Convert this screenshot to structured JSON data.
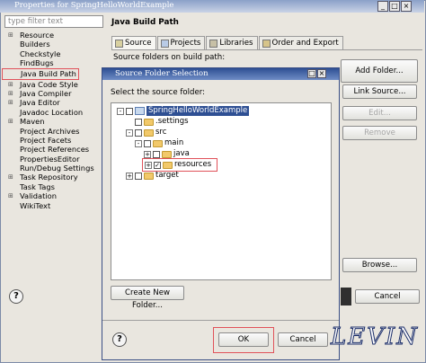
{
  "outer": {
    "title": "Properties for SpringHelloWorldExample",
    "filter_placeholder": "type filter text"
  },
  "left_tree": {
    "items": [
      {
        "label": "Resource",
        "expandable": true
      },
      {
        "label": "Builders",
        "expandable": false
      },
      {
        "label": "Checkstyle",
        "expandable": false
      },
      {
        "label": "FindBugs",
        "expandable": false
      },
      {
        "label": "Java Build Path",
        "expandable": false,
        "highlighted": true
      },
      {
        "label": "Java Code Style",
        "expandable": true
      },
      {
        "label": "Java Compiler",
        "expandable": true
      },
      {
        "label": "Java Editor",
        "expandable": true
      },
      {
        "label": "Javadoc Location",
        "expandable": false
      },
      {
        "label": "Maven",
        "expandable": true
      },
      {
        "label": "Project Archives",
        "expandable": false
      },
      {
        "label": "Project Facets",
        "expandable": false
      },
      {
        "label": "Project References",
        "expandable": false
      },
      {
        "label": "PropertiesEditor",
        "expandable": false
      },
      {
        "label": "Run/Debug Settings",
        "expandable": false
      },
      {
        "label": "Task Repository",
        "expandable": true
      },
      {
        "label": "Task Tags",
        "expandable": false
      },
      {
        "label": "Validation",
        "expandable": true
      },
      {
        "label": "WikiText",
        "expandable": false
      }
    ]
  },
  "build_path": {
    "title": "Java Build Path",
    "tabs": [
      "Source",
      "Projects",
      "Libraries",
      "Order and Export"
    ],
    "source_folders_label": "Source folders on build path:",
    "buttons": {
      "add_folder": "Add Folder...",
      "link_source": "Link Source...",
      "edit": "Edit...",
      "remove": "Remove",
      "browse": "Browse...",
      "cancel": "Cancel"
    }
  },
  "dialog": {
    "title": "Source Folder Selection",
    "prompt": "Select the source folder:",
    "tree": [
      {
        "label": "SpringHelloWorldExample",
        "level": 0,
        "kind": "project",
        "expander": "-",
        "checked": false,
        "selected": true
      },
      {
        "label": ".settings",
        "level": 1,
        "kind": "folder",
        "expander": "",
        "checked": false
      },
      {
        "label": "src",
        "level": 1,
        "kind": "folder",
        "expander": "-",
        "checked": false
      },
      {
        "label": "main",
        "level": 2,
        "kind": "folder",
        "expander": "-",
        "checked": false
      },
      {
        "label": "java",
        "level": 3,
        "kind": "folder",
        "expander": "+",
        "checked": false
      },
      {
        "label": "resources",
        "level": 3,
        "kind": "folder",
        "expander": "+",
        "checked": true,
        "highlighted": true
      },
      {
        "label": "target",
        "level": 1,
        "kind": "folder",
        "expander": "+",
        "checked": false
      }
    ],
    "buttons": {
      "new_folder": "Create New Folder...",
      "ok": "OK",
      "cancel": "Cancel"
    }
  },
  "watermark": "LEVIN",
  "colors": {
    "highlight_box": "#e0525a",
    "selection": "#2e4f93",
    "title_bar": "#6e8cc6"
  }
}
